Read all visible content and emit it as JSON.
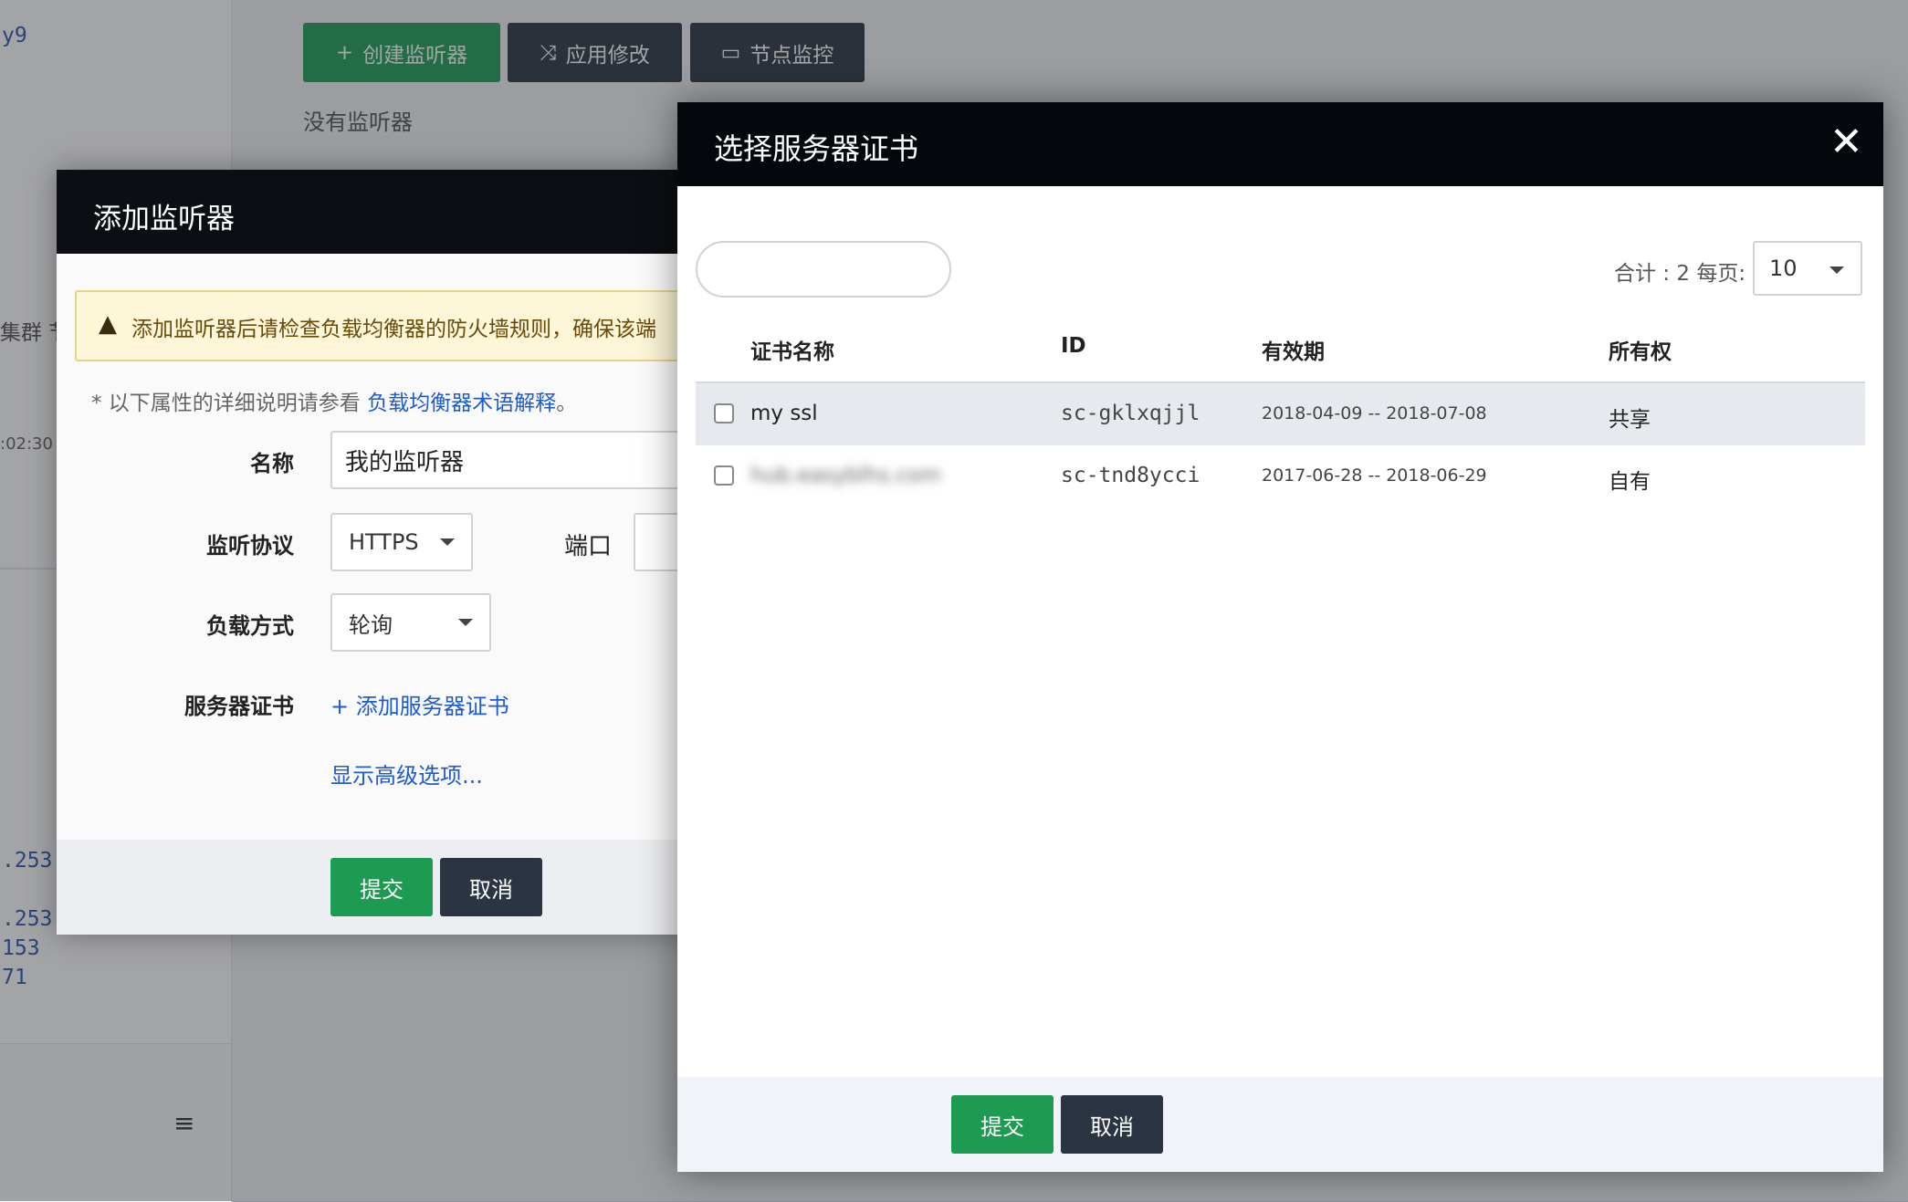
{
  "background": {
    "toolbar": {
      "create_label": "创建监听器",
      "apply_label": "应用修改",
      "monitor_label": "节点监控"
    },
    "empty_text": "没有监听器",
    "sidebar": {
      "top_text": "y9",
      "cluster_text": "集群 节",
      "time_text": ":02:30",
      "ip_lines": [
        ".253",
        ".253",
        "153",
        "71"
      ]
    }
  },
  "add_listener": {
    "title": "添加监听器",
    "warning": "添加监听器后请检查负载均衡器的防火墙规则，确保该端",
    "hint_prefix": "* 以下属性的详细说明请参看",
    "hint_link": "负载均衡器术语解释",
    "hint_suffix": "。",
    "name_label": "名称",
    "name_value": "我的监听器",
    "protocol_label": "监听协议",
    "protocol_value": "HTTPS",
    "port_label": "端口",
    "lb_label": "负载方式",
    "lb_value": "轮询",
    "cert_label": "服务器证书",
    "add_cert_link": "+ 添加服务器证书",
    "advanced_link": "显示高级选项...",
    "submit_label": "提交",
    "cancel_label": "取消"
  },
  "select_cert": {
    "title": "选择服务器证书",
    "close_glyph": "✕",
    "total_label": "合计 : 2  每页:",
    "per_page_value": "10",
    "columns": [
      "证书名称",
      "ID",
      "有效期",
      "所有权"
    ],
    "rows": [
      {
        "name": "my ssl",
        "id": "sc-gklxqjjl",
        "validity": "2018-04-09 -- 2018-07-08",
        "owner": "共享"
      },
      {
        "name": "hub.easyblhs.com",
        "id": "sc-tnd8ycci",
        "validity": "2017-06-28 -- 2018-06-29",
        "owner": "自有"
      }
    ],
    "submit_label": "提交",
    "cancel_label": "取消"
  },
  "icons": {
    "plus": "+",
    "shuffle": "⤨",
    "monitor": "▭",
    "warning": "▲",
    "hamburger": "≡"
  }
}
